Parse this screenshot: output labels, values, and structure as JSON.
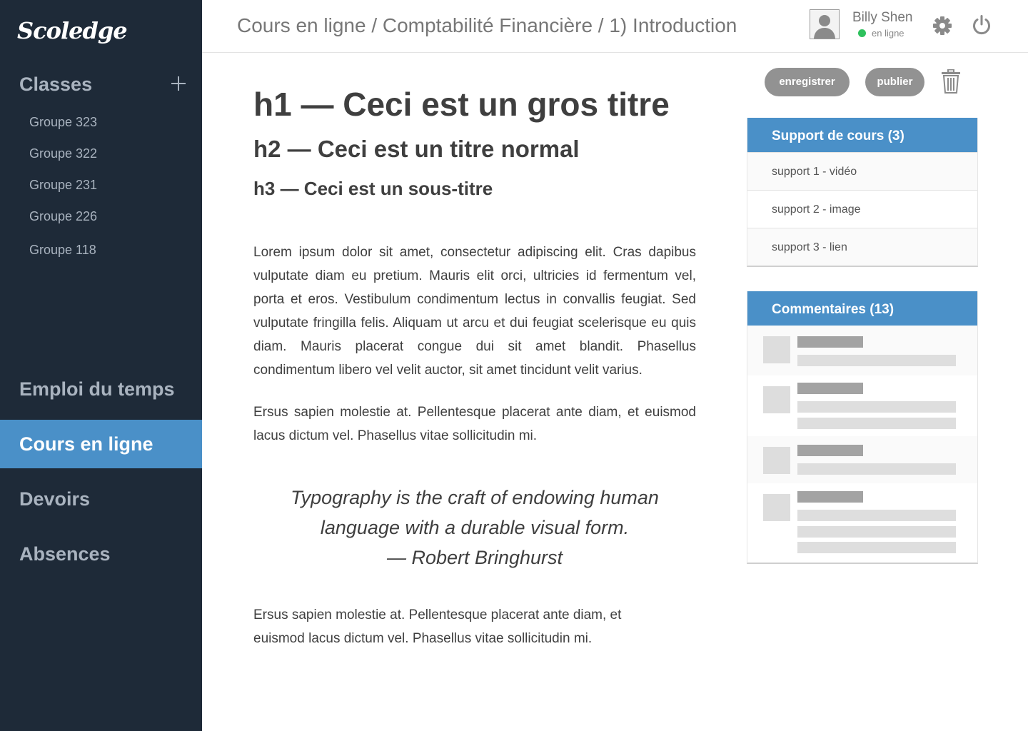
{
  "app": {
    "logo": "Scoledge"
  },
  "sidebar": {
    "classes_title": "Classes",
    "groups": [
      "Groupe 323",
      "Groupe 322",
      "Groupe 231",
      "Groupe 226",
      "Groupe 118"
    ],
    "nav": [
      {
        "label": "Emploi du temps",
        "active": false
      },
      {
        "label": "Cours en ligne",
        "active": true
      },
      {
        "label": "Devoirs",
        "active": false
      },
      {
        "label": "Absences",
        "active": false
      }
    ]
  },
  "header": {
    "breadcrumb": "Cours en ligne / Comptabilité Financière / 1) Introduction",
    "user_name": "Billy Shen",
    "user_status": "en ligne",
    "status_color": "#2ec15d",
    "icons": [
      "avatar-icon",
      "gear-icon",
      "power-icon"
    ]
  },
  "article": {
    "h1": "h1 — Ceci est un gros titre",
    "h2": "h2 — Ceci est un titre normal",
    "h3": "h3 — Ceci est un sous-titre",
    "p1": "Lorem ipsum dolor sit amet, consectetur adipiscing elit. Cras dapibus vulputate diam eu pretium. Mauris elit orci, ultricies id fermentum vel, porta et eros. Vestibulum condimentum lectus in convallis feugiat. Sed vulputate fringilla felis. Aliquam ut arcu et dui feugiat scelerisque eu quis diam. Mauris placerat congue dui sit amet blandit. Phasellus condimentum libero vel velit auctor, sit amet tincidunt velit varius.",
    "p2": "Ersus sapien molestie at. Pellentesque placerat ante diam, et euismod lacus dictum vel. Phasellus vitae sollicitudin mi.",
    "quote_line1": "Typography is the craft of endowing human",
    "quote_line2": "language with a durable visual form.",
    "quote_author": "— Robert Bringhurst",
    "p3": "Ersus sapien molestie at. Pellentesque placerat ante diam, et euismod lacus dictum vel. Phasellus vitae sollicitudin mi."
  },
  "actions": {
    "save_label": "enregistrer",
    "publish_label": "publier"
  },
  "support": {
    "title": "Support de cours (3)",
    "items": [
      "support 1 - vidéo",
      "support 2 - image",
      "support 3 - lien"
    ]
  },
  "comments": {
    "title": "Commentaires (13)"
  },
  "colors": {
    "sidebar_bg": "#1e2a38",
    "accent": "#4a90c8",
    "button": "#929292"
  }
}
